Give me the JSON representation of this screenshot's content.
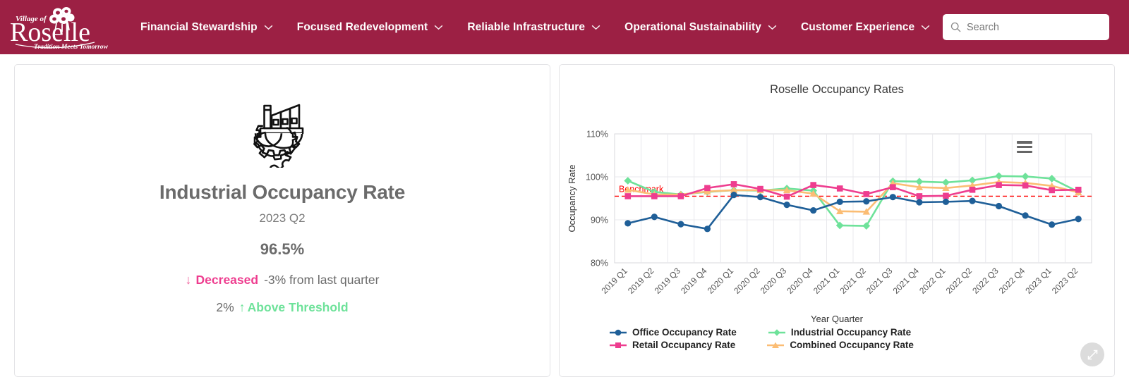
{
  "header": {
    "logo": {
      "top": "Village of",
      "name": "Roselle",
      "tagline": "Tradition Meets Tomorrow"
    },
    "nav": [
      {
        "label": "Financial Stewardship",
        "icon": "chevron-down-icon"
      },
      {
        "label": "Focused Redevelopment",
        "icon": "chevron-down-icon"
      },
      {
        "label": "Reliable Infrastructure",
        "icon": "chevron-down-icon"
      },
      {
        "label": "Operational Sustainability",
        "icon": "chevron-down-icon"
      },
      {
        "label": "Customer Experience",
        "icon": "chevron-down-icon"
      }
    ],
    "search": {
      "placeholder": "Search",
      "value": "",
      "icon": "search-icon"
    },
    "brand_color": "#9c2044"
  },
  "kpi": {
    "icon": "factory-gear-icon",
    "title": "Industrial Occupancy Rate",
    "period": "2023 Q2",
    "value": "96.5%",
    "change_arrow": "↓",
    "change_word": "Decreased",
    "change_detail": "-3% from last quarter",
    "threshold_amount": "2%",
    "threshold_arrow": "↑",
    "threshold_word": "Above Threshold",
    "decrease_color": "#ee3d8f",
    "threshold_color": "#6ee29a"
  },
  "chart_panel": {
    "menu_icon": "hamburger-menu-icon",
    "resize_icon": "resize-expand-icon"
  },
  "chart_data": {
    "type": "line",
    "title": "Roselle Occupancy Rates",
    "xlabel": "Year Quarter",
    "ylabel": "Occupancy Rate",
    "ylim": [
      80,
      110
    ],
    "yticks": [
      80,
      90,
      100,
      110
    ],
    "ytick_labels": [
      "80%",
      "90%",
      "100%",
      "110%"
    ],
    "grid": true,
    "legend_position": "bottom-left",
    "categories": [
      "2019 Q1",
      "2019 Q2",
      "2019 Q3",
      "2019 Q4",
      "2020 Q1",
      "2020 Q2",
      "2020 Q3",
      "2020 Q4",
      "2021 Q1",
      "2021 Q2",
      "2021 Q3",
      "2021 Q4",
      "2022 Q1",
      "2022 Q2",
      "2022 Q3",
      "2022 Q4",
      "2023 Q1",
      "2023 Q2"
    ],
    "annotations": [
      {
        "label": "Benchmark",
        "type": "hline",
        "value": 95.5,
        "color": "#ff0000",
        "style": "dashed"
      }
    ],
    "series": [
      {
        "name": "Office Occupancy Rate",
        "color": "#1f5f98",
        "marker": "circle",
        "values": [
          89.2,
          90.7,
          89.0,
          87.9,
          95.8,
          95.3,
          93.5,
          92.2,
          94.2,
          94.3,
          95.3,
          94.1,
          94.2,
          94.4,
          93.2,
          91.0,
          88.9,
          90.2
        ]
      },
      {
        "name": "Industrial Occupancy Rate",
        "color": "#6ee29a",
        "marker": "diamond",
        "values": [
          99.1,
          96.5,
          95.9,
          96.5,
          96.9,
          96.8,
          97.3,
          96.8,
          88.7,
          88.6,
          99.0,
          98.9,
          98.7,
          99.2,
          100.2,
          100.1,
          99.6,
          96.5
        ]
      },
      {
        "name": "Retail Occupancy Rate",
        "color": "#ee3d8f",
        "marker": "square",
        "values": [
          95.5,
          95.5,
          95.5,
          97.4,
          98.3,
          97.2,
          95.4,
          98.1,
          97.3,
          96.0,
          97.6,
          95.5,
          95.6,
          97.0,
          98.1,
          98.0,
          96.9,
          97.0
        ]
      },
      {
        "name": "Combined Occupancy Rate",
        "color": "#fbbd74",
        "marker": "triangle",
        "values": [
          97.0,
          95.9,
          95.9,
          96.6,
          96.9,
          96.9,
          96.9,
          96.1,
          92.0,
          91.9,
          98.5,
          97.6,
          97.4,
          98.0,
          98.8,
          98.6,
          97.9,
          96.4
        ]
      }
    ]
  }
}
